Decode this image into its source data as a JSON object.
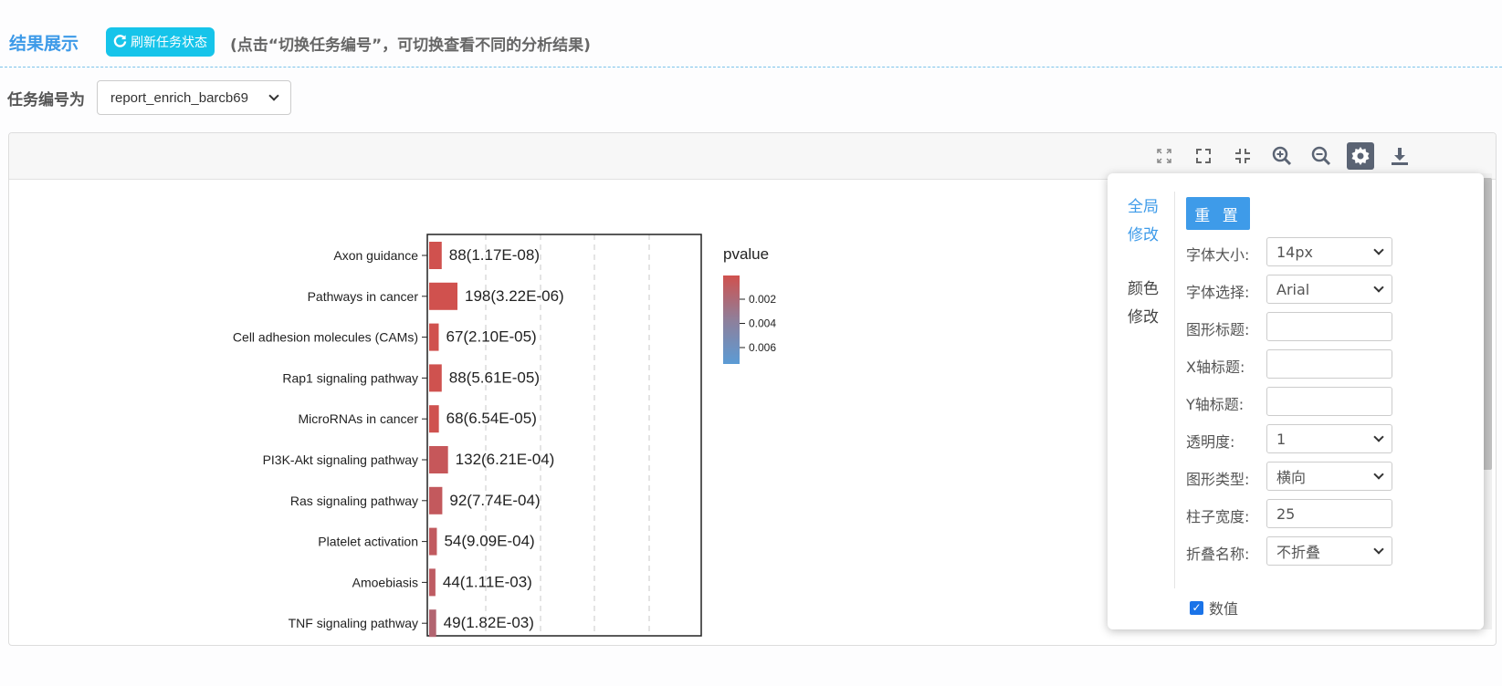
{
  "header": {
    "title": "结果展示",
    "refresh_label": "刷新任务状态",
    "hint": "(点击“切换任务编号”，可切换查看不同的分析结果)"
  },
  "task": {
    "label": "任务编号为",
    "selected": "report_enrich_barcb69"
  },
  "toolbar": {
    "icons": [
      "expand-icon",
      "fullscreen-icon",
      "shrink-icon",
      "zoom-in-icon",
      "zoom-out-icon",
      "settings-icon",
      "download-icon"
    ]
  },
  "settings": {
    "tabs": [
      "全局修改",
      "颜色修改"
    ],
    "reset_label": "重 置",
    "fields": [
      {
        "label": "字体大小:",
        "value": "14px",
        "type": "select"
      },
      {
        "label": "字体选择:",
        "value": "Arial",
        "type": "select"
      },
      {
        "label": "图形标题:",
        "value": "",
        "type": "input"
      },
      {
        "label": "X轴标题:",
        "value": "",
        "type": "input"
      },
      {
        "label": "Y轴标题:",
        "value": "",
        "type": "input"
      },
      {
        "label": "透明度:",
        "value": "1",
        "type": "select"
      },
      {
        "label": "图形类型:",
        "value": "横向",
        "type": "select"
      },
      {
        "label": "柱子宽度:",
        "value": "25",
        "type": "input"
      },
      {
        "label": "折叠名称:",
        "value": "不折叠",
        "type": "select"
      }
    ],
    "numbers_label": "数值",
    "numbers_checked": true
  },
  "chart_data": {
    "type": "bar",
    "orientation": "horizontal",
    "categories": [
      "Axon guidance",
      "Pathways in cancer",
      "Cell adhesion molecules (CAMs)",
      "Rap1 signaling pathway",
      "MicroRNAs in cancer",
      "PI3K-Akt signaling pathway",
      "Ras signaling pathway",
      "Platelet activation",
      "Amoebiasis",
      "TNF signaling pathway"
    ],
    "values": [
      88,
      198,
      67,
      88,
      68,
      132,
      92,
      54,
      44,
      49
    ],
    "labels": [
      "88(1.17E-08)",
      "198(3.22E-06)",
      "67(2.10E-05)",
      "88(5.61E-05)",
      "68(6.54E-05)",
      "132(6.21E-04)",
      "92(7.74E-04)",
      "54(9.09E-04)",
      "44(1.11E-03)",
      "49(1.82E-03)"
    ],
    "pvalues": [
      1.17e-08,
      3.22e-06,
      2.1e-05,
      5.61e-05,
      6.54e-05,
      0.000621,
      0.000774,
      0.000909,
      0.00111,
      0.00182
    ],
    "legend": {
      "title": "pvalue",
      "ticks": [
        "0.002",
        "0.004",
        "0.006"
      ],
      "colors": [
        "#d0514e",
        "#8f7f9a",
        "#5b9bd5"
      ]
    },
    "bar_color": "#d0514e",
    "grid": "dashed vertical"
  }
}
